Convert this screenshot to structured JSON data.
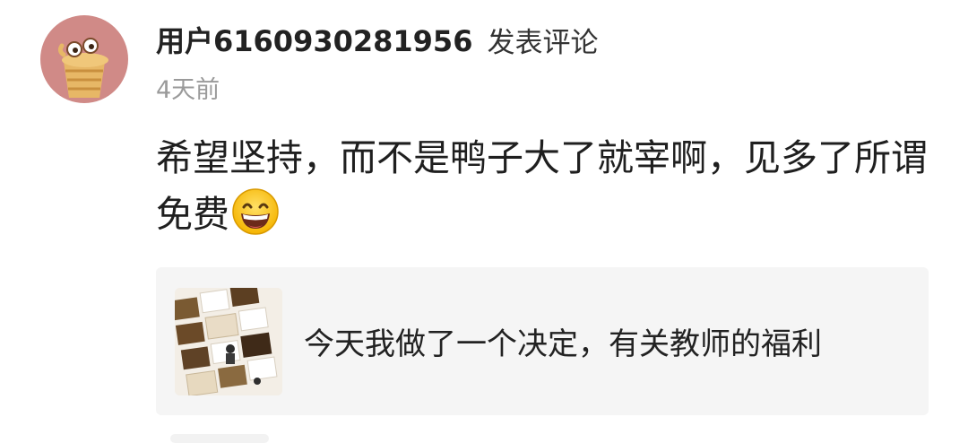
{
  "comment": {
    "user_name": "用户6160930281956",
    "action_text": "发表评论",
    "time_ago": "4天前",
    "text": "希望坚持，而不是鸭子大了就宰啊，见多了所谓免费",
    "emoji_icon": "grinning-face-icon"
  },
  "linked_article": {
    "title": "今天我做了一个决定，有关教师的福利"
  },
  "colors": {
    "avatar_bg": "#d08a87",
    "card_bg": "#f5f5f5",
    "muted_text": "#9a9a9a"
  }
}
